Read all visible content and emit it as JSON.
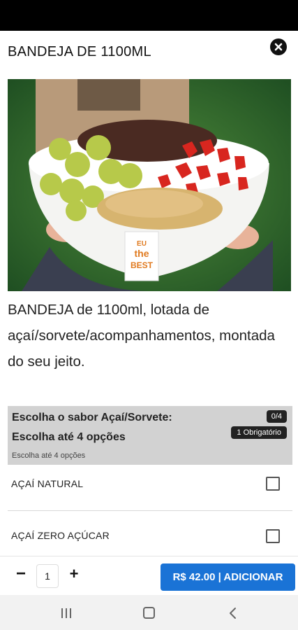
{
  "header": {
    "title": "BANDEJA DE 1100ML"
  },
  "product": {
    "image_alt": "Bowl de açaí com uvas, morangos e farofa",
    "cup_label_line1": "EU",
    "cup_label_line2": "the",
    "cup_label_line3": "BEST",
    "description": "BANDEJA de 1100ml, lotada de açaí/sorvete/acompanhamentos, montada do seu jeito."
  },
  "option_group": {
    "title": "Escolha o sabor Açaí/Sorvete:",
    "subtitle": "Escolha até 4 opções",
    "hint": "Escolha até 4 opções",
    "count_badge": "0/4",
    "required_badge": "1 Obrigatório",
    "options": [
      {
        "label": "AÇAÍ NATURAL",
        "checked": false
      },
      {
        "label": "AÇAÍ ZERO AÇÚCAR",
        "checked": false
      }
    ]
  },
  "footer": {
    "minus": "−",
    "quantity": "1",
    "plus": "+",
    "add_button": "R$ 42.00 | ADICIONAR"
  },
  "colors": {
    "accent": "#1a73d6",
    "group_bg": "#d2d2d2",
    "badge_bg": "#222222"
  },
  "icons": {
    "close": "close-circle-icon",
    "recents": "recents-icon",
    "home": "home-icon",
    "back": "back-icon"
  }
}
